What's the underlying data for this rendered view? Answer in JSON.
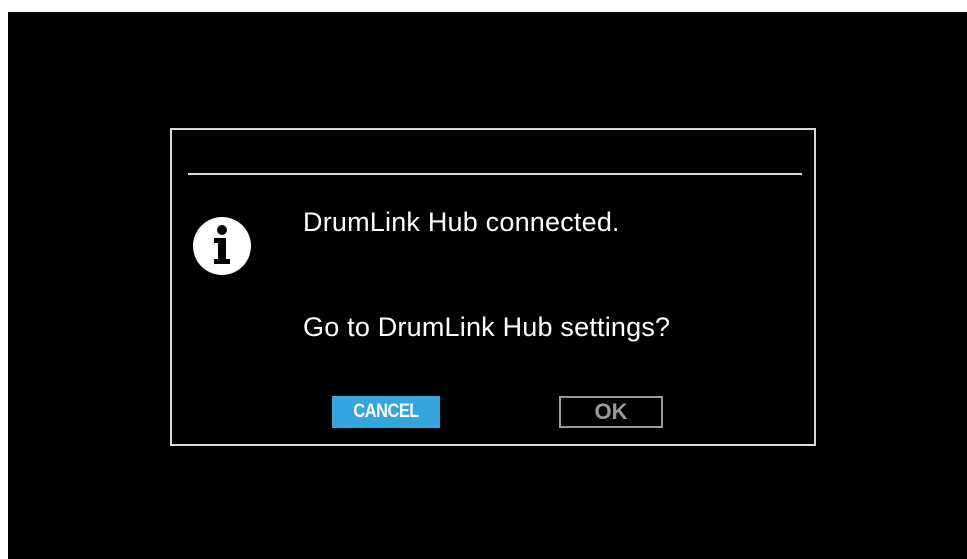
{
  "dialog": {
    "icon": "info-icon",
    "message_line_1": "DrumLink Hub connected.",
    "message_line_2": "Go to DrumLink Hub settings?",
    "buttons": {
      "cancel_label": "CANCEL",
      "ok_label": "OK"
    },
    "selected_button": "CANCEL"
  },
  "colors": {
    "background": "#000000",
    "dialog_border": "#d8d8d8",
    "text": "#ffffff",
    "selected_button": "#36a5de",
    "disabled_button": "#9a9a9a"
  }
}
